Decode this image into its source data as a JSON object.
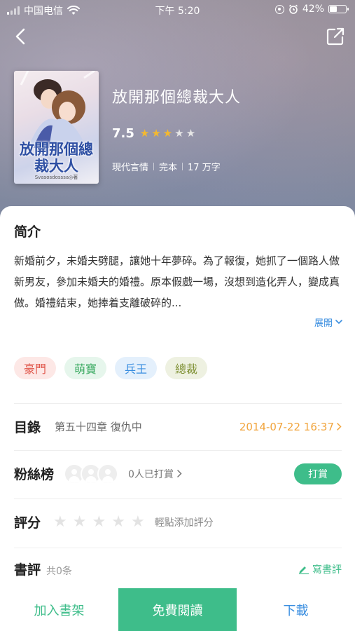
{
  "status_bar": {
    "carrier": "中国电信",
    "time": "下午 5:20",
    "battery": "42%"
  },
  "book": {
    "title": "放開那個總裁大人",
    "score": "7.5",
    "stars_filled": 3,
    "stars_total": 5,
    "genre": "現代言情",
    "status": "完本",
    "word_count": "17 万字",
    "cover_title": "放開那個總裁大人",
    "cover_author": "Svasosdosssa◎著"
  },
  "intro": {
    "heading": "简介",
    "text": "新婚前夕，未婚夫劈腿，讓她十年夢碎。為了報復，她抓了一個路人做新男友，參加未婚夫的婚禮。原本假戲一場，沒想到造化弄人，變成真做。婚禮結束，她捧着支離破碎的...",
    "expand_label": "展開"
  },
  "tags": [
    "豪門",
    "萌寶",
    "兵王",
    "總裁"
  ],
  "toc": {
    "label": "目錄",
    "latest_chapter": "第五十四章 復仇中",
    "updated": "2014-07-22 16:37"
  },
  "fans": {
    "label": "粉絲榜",
    "count_text": "0人已打賞",
    "tip_label": "打賞"
  },
  "rating": {
    "label": "評分",
    "hint": "輕點添加評分"
  },
  "reviews": {
    "label": "書評",
    "count_text": "共0条",
    "write_label": "寫書評"
  },
  "bottom_bar": {
    "add_shelf": "加入書架",
    "read_free": "免費閱讀",
    "download": "下載"
  },
  "colors": {
    "accent_green": "#3ebd8a",
    "link_blue": "#3a8ee0",
    "date_orange": "#f1a43c",
    "star_gold": "#f5b92e"
  }
}
